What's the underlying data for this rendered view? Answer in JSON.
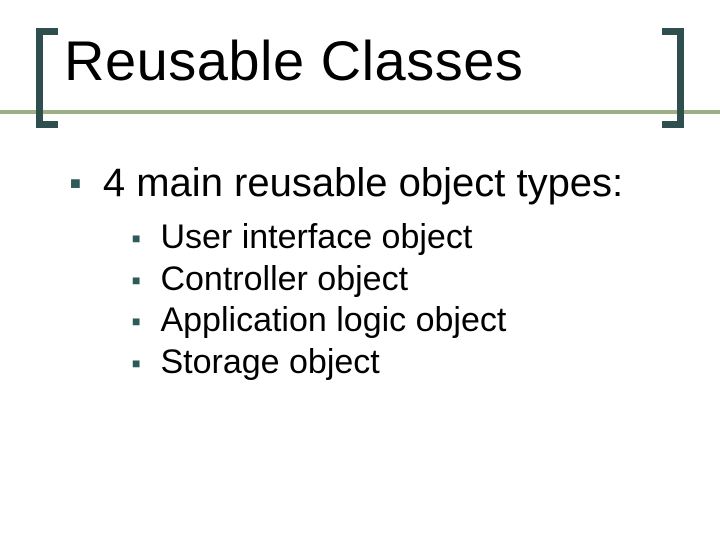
{
  "title": "Reusable Classes",
  "main_point": "4 main reusable object types:",
  "sub_points": [
    "User interface object",
    "Controller object",
    "Application logic object",
    "Storage object"
  ]
}
